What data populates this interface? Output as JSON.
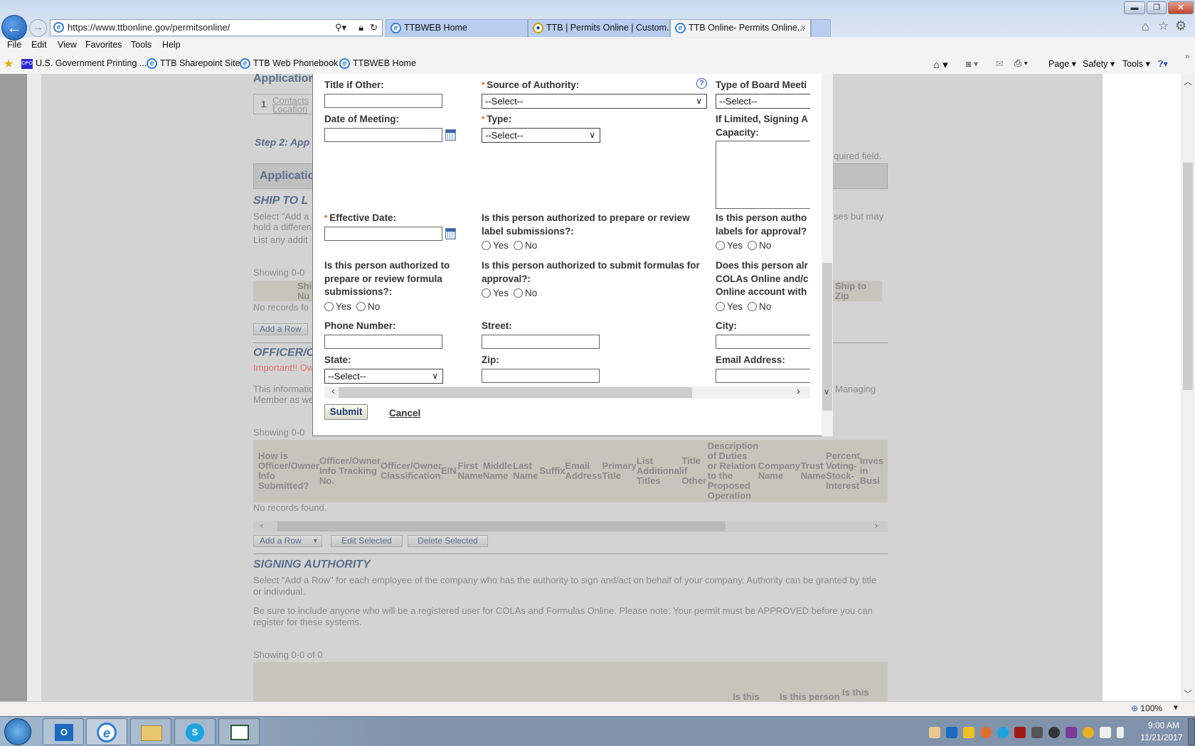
{
  "browser": {
    "address": "https://www.ttbonline.gov/permitsonline/",
    "tabs": [
      {
        "label": "TTBWEB Home",
        "active": false
      },
      {
        "label": "TTB | Permits Online | Custom...",
        "active": false
      },
      {
        "label": "TTB Online- Permits Online...",
        "active": true
      }
    ],
    "close_tab": "×",
    "menu": [
      "File",
      "Edit",
      "View",
      "Favorites",
      "Tools",
      "Help"
    ],
    "favorites": [
      "U.S. Government Printing ...",
      "TTB Sharepoint Site",
      "TTB Web Phonebook",
      "TTBWEB Home"
    ],
    "gpo_logo": "GPO",
    "commands": [
      "Page",
      "Safety",
      "Tools"
    ],
    "zoom": "100%"
  },
  "background_page": {
    "app_heading": "Applicatior",
    "step_number": "1",
    "step_label_1": "Contacts",
    "step_label_2": "Location",
    "step_title": "Step 2: App",
    "required_note": "quired field.",
    "app_bar": "Applicatio",
    "ship_heading": "SHIP TO L",
    "ship_text_1": "Select \"Add a I",
    "ship_text_1b": "ses but may",
    "ship_text_2": "hold a different",
    "ship_text_3": "List any addit",
    "ship_showing": "Showing 0-0",
    "ship_col_1": "Shi Nu",
    "ship_col_last": "Ship to Zip",
    "ship_no_records": "No records fo",
    "add_row": "Add a Row",
    "officer_heading": "OFFICER/O",
    "officer_important": "Important!! Ow",
    "officer_text_1": "This informatio",
    "officer_text_1b": "Managing",
    "officer_text_2": "Member as we",
    "officer_showing": "Showing 0-0",
    "officer_columns": [
      "How is Officer/Owner Info Submitted?",
      "Officer/Owner Info Tracking No.",
      "Officer/Owner Classification",
      "EIN",
      "First Name",
      "Middle Name",
      "Last Name",
      "Suffix",
      "Email Address",
      "Primary Title",
      "List Additional Titles",
      "Title if Other",
      "Description of Duties or Relation to the Proposed Operation",
      "Company Name",
      "Trust Name",
      "Percent Voting-Stock-Interest",
      "Inves in Busi"
    ],
    "officer_no_records": "No records found.",
    "edit_selected": "Edit Selected",
    "delete_selected": "Delete Selected",
    "signing_heading": "SIGNING AUTHORITY",
    "signing_text_1": "Select \"Add a Row\" for each employee of the company who has the authority to sign and/act on behalf of your company. Authority can be granted by title or individual.",
    "signing_text_2": "Be sure to include anyone who will be a registered user for COLAs and Formulas Online. Please note: Your permit must be APPROVED before you can register for these systems.",
    "signing_showing": "Showing 0-0 of 0",
    "signing_partial_cols": [
      "Is this",
      "Is this person",
      "Is this"
    ]
  },
  "modal": {
    "title_if_other": "Title if Other:",
    "source_of_authority": "Source of Authority:",
    "source_value": "--Select--",
    "help_icon": "?",
    "type_of_board": "Type of Board Meeti",
    "board_value": "--Select--",
    "date_of_meeting": "Date of Meeting:",
    "type": "Type:",
    "type_value": "--Select--",
    "if_limited": "If Limited, Signing A Capacity:",
    "effective_date": "Effective Date:",
    "q_label": "Is this person authorized to prepare or review label submissions?:",
    "q_labels_approval": "Is this person autho labels for approval?",
    "q_formula_review": "Is this person authorized to prepare or review formula submissions?:",
    "q_formula_submit": "Is this person authorized to submit formulas for approval?:",
    "q_already": "Does this person alr COLAs Online and/c Online account with",
    "yes": "Yes",
    "no": "No",
    "phone": "Phone Number:",
    "street": "Street:",
    "city": "City:",
    "state": "State:",
    "state_value": "--Select--",
    "zip": "Zip:",
    "email": "Email Address:",
    "submit": "Submit",
    "cancel": "Cancel"
  },
  "taskbar": {
    "time": "9:00 AM",
    "date": "11/21/2017"
  },
  "colors": {
    "required": "#e05a00",
    "heading": "#5a6f8c",
    "important": "#e03030"
  }
}
